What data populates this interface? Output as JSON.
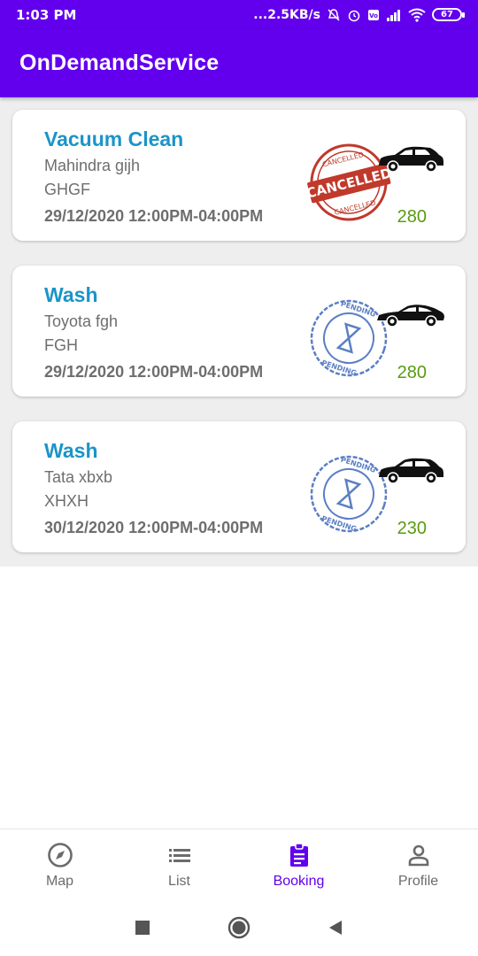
{
  "status_bar": {
    "time": "1:03 PM",
    "network_speed": "...2.5KB/s",
    "battery": "67",
    "icons": [
      "mute-icon",
      "alarm-icon",
      "volte-icon",
      "signal-icon",
      "wifi-icon",
      "battery-icon"
    ]
  },
  "app_bar": {
    "title": "OnDemandService"
  },
  "bookings": [
    {
      "service": "Vacuum Clean",
      "vehicle": "Mahindra gijh",
      "plate": "GHGF",
      "datetime": "29/12/2020 12:00PM-04:00PM",
      "price": "280",
      "status_stamp": "CANCELLED"
    },
    {
      "service": "Wash",
      "vehicle": "Toyota fgh",
      "plate": "FGH",
      "datetime": "29/12/2020 12:00PM-04:00PM",
      "price": "280",
      "status_stamp": "PENDING"
    },
    {
      "service": "Wash",
      "vehicle": "Tata xbxb",
      "plate": "XHXH",
      "datetime": "30/12/2020 12:00PM-04:00PM",
      "price": "230",
      "status_stamp": "PENDING"
    }
  ],
  "bottom_nav": {
    "items": [
      {
        "label": "Map",
        "icon": "compass-icon"
      },
      {
        "label": "List",
        "icon": "list-icon"
      },
      {
        "label": "Booking",
        "icon": "clipboard-icon",
        "active": true
      },
      {
        "label": "Profile",
        "icon": "person-icon"
      }
    ]
  },
  "system_nav": {
    "icons": [
      "recents-icon",
      "home-icon",
      "back-icon"
    ]
  },
  "colors": {
    "primary": "#6200ee",
    "title_blue": "#1b94c8",
    "price_green": "#5a9a12",
    "text_gray": "#6e6e6e",
    "cancelled_red": "#c0392b",
    "pending_blue": "#5b7fc4"
  }
}
